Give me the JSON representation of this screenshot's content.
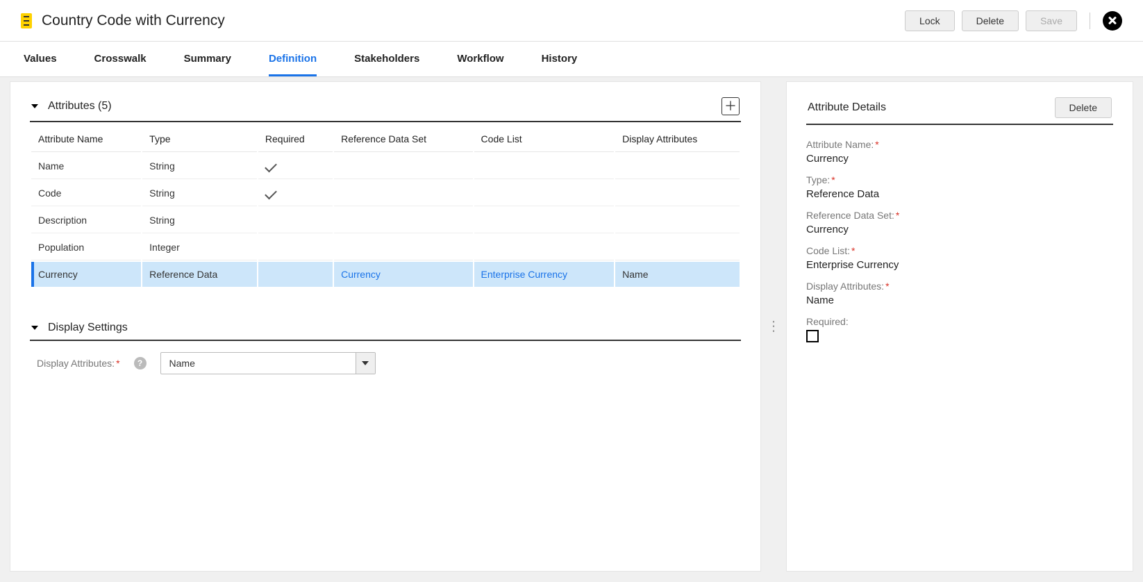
{
  "header": {
    "title": "Country Code with Currency",
    "actions": {
      "lock": "Lock",
      "delete": "Delete",
      "save": "Save"
    }
  },
  "tabs": [
    {
      "label": "Values",
      "active": false
    },
    {
      "label": "Crosswalk",
      "active": false
    },
    {
      "label": "Summary",
      "active": false
    },
    {
      "label": "Definition",
      "active": true
    },
    {
      "label": "Stakeholders",
      "active": false
    },
    {
      "label": "Workflow",
      "active": false
    },
    {
      "label": "History",
      "active": false
    }
  ],
  "attributes": {
    "section_title": "Attributes (5)",
    "columns": {
      "name": "Attribute Name",
      "type": "Type",
      "required": "Required",
      "refset": "Reference Data Set",
      "codelist": "Code List",
      "display": "Display Attributes"
    },
    "rows": [
      {
        "name": "Name",
        "type": "String",
        "required": true,
        "refset": "",
        "codelist": "",
        "display": "",
        "selected": false
      },
      {
        "name": "Code",
        "type": "String",
        "required": true,
        "refset": "",
        "codelist": "",
        "display": "",
        "selected": false
      },
      {
        "name": "Description",
        "type": "String",
        "required": false,
        "refset": "",
        "codelist": "",
        "display": "",
        "selected": false
      },
      {
        "name": "Population",
        "type": "Integer",
        "required": false,
        "refset": "",
        "codelist": "",
        "display": "",
        "selected": false
      },
      {
        "name": "Currency",
        "type": "Reference Data",
        "required": false,
        "refset": "Currency",
        "codelist": "Enterprise Currency",
        "display": "Name",
        "selected": true,
        "refset_link": true,
        "codelist_link": true
      }
    ]
  },
  "display_settings": {
    "section_title": "Display Settings",
    "label": "Display Attributes:",
    "value": "Name"
  },
  "details": {
    "panel_title": "Attribute Details",
    "delete_label": "Delete",
    "name_label": "Attribute Name:",
    "name_value": "Currency",
    "type_label": "Type:",
    "type_value": "Reference Data",
    "refset_label": "Reference Data Set:",
    "refset_value": "Currency",
    "codelist_label": "Code List:",
    "codelist_value": "Enterprise Currency",
    "display_label": "Display Attributes:",
    "display_value": "Name",
    "required_label": "Required:",
    "required_checked": false
  }
}
